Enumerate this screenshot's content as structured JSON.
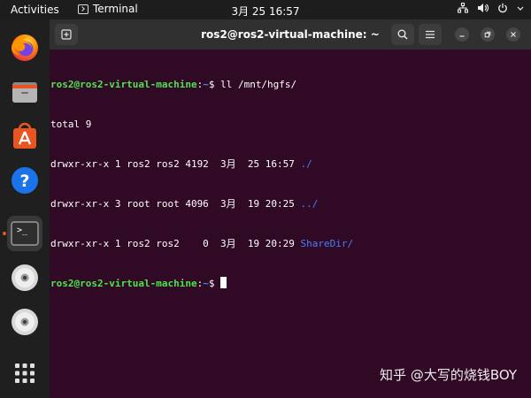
{
  "topbar": {
    "activities": "Activities",
    "app_name": "Terminal",
    "clock": "3月 25  16:57",
    "tray": [
      "network-icon",
      "volume-icon",
      "power-icon"
    ]
  },
  "dock": {
    "items": [
      {
        "name": "firefox-icon"
      },
      {
        "name": "files-icon"
      },
      {
        "name": "software-icon"
      },
      {
        "name": "help-icon"
      },
      {
        "name": "terminal-icon",
        "running": true
      },
      {
        "name": "cd-drive-icon"
      },
      {
        "name": "cd-drive-icon"
      },
      {
        "name": "show-apps-icon"
      }
    ],
    "terminal_glyph": ">_"
  },
  "window": {
    "title": "ros2@ros2-virtual-machine: ~"
  },
  "terminal": {
    "prompt_user": "ros2@ros2-virtual-machine",
    "prompt_path": "~",
    "prompt_end": "$ ",
    "command": "ll /mnt/hgfs/",
    "total": "total 9",
    "rows": [
      {
        "text": "drwxr-xr-x 1 ros2 ros2 4192  3月  25 16:57 ",
        "name": "./"
      },
      {
        "text": "drwxr-xr-x 3 root root 4096  3月  19 20:25 ",
        "name": "../"
      },
      {
        "text": "drwxr-xr-x 1 ros2 ros2    0  3月  19 20:29 ",
        "name": "ShareDir/"
      }
    ]
  },
  "watermark": "知乎 @大写的烧钱BOY",
  "colors": {
    "terminal_bg": "#300a24",
    "prompt_user": "#4ee44e",
    "prompt_path": "#3f8cff",
    "accent": "#e95420"
  }
}
